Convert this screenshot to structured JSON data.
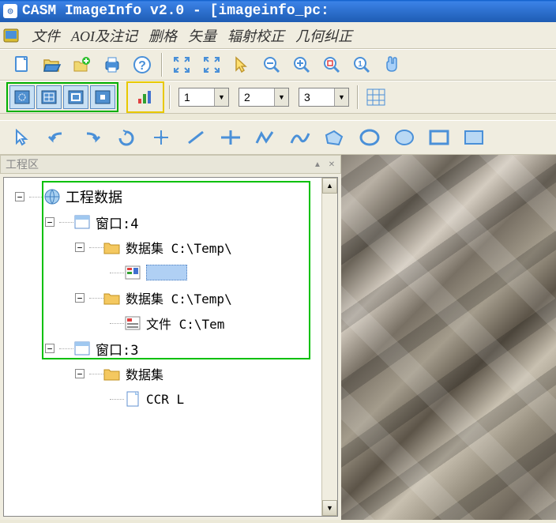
{
  "title": "CASM ImageInfo v2.0  -  [imageinfo_pc:",
  "menu": {
    "file": "文件",
    "aoi": "AOI及注记",
    "raster": "删格",
    "vector": "矢量",
    "radiometric": "辐射校正",
    "geometric": "几何纠正"
  },
  "dropdowns": {
    "band1": "1",
    "band2": "2",
    "band3": "3"
  },
  "panel": {
    "title": "工程区",
    "root": "工程数据",
    "window1": "窗口:4",
    "window2": "窗口:3",
    "dataset_label": "数据集",
    "dataset1": "数据集 C:\\Temp\\",
    "dataset2": "数据集 C:\\Temp\\",
    "file_label": "文件 C:\\Tem",
    "layer_label": "CCR L"
  }
}
